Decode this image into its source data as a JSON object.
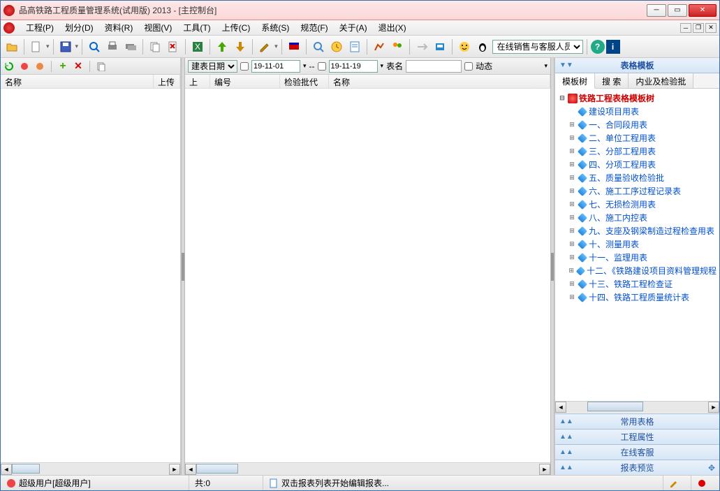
{
  "title": "品高铁路工程质量管理系统(试用版) 2013 - [主控制台]",
  "menu": {
    "project": "工程(P)",
    "division": "划分(D)",
    "data": "资料(R)",
    "view": "视图(V)",
    "tools": "工具(T)",
    "upload": "上传(C)",
    "system": "系统(S)",
    "spec": "规范(F)",
    "about": "关于(A)",
    "exit": "退出(X)"
  },
  "toolbar": {
    "sales_label": "在线销售与客服人员"
  },
  "left": {
    "col_name": "名称",
    "col_upload": "上传"
  },
  "center": {
    "date_type_label": "建表日期",
    "date_from": "19-11-01",
    "date_sep": "--",
    "date_to": "19-11-19",
    "table_name_label": "表名",
    "dynamic_label": "动态",
    "col_upload": "上传",
    "col_number": "编号",
    "col_batch": "检验批代号",
    "col_name": "名称"
  },
  "right": {
    "header": "表格模板",
    "tabs": {
      "tree": "模板树",
      "search": "搜 索",
      "batch": "内业及检验批"
    },
    "root": "铁路工程表格模板树",
    "children": [
      "建设项目用表",
      "一、合同段用表",
      "二、单位工程用表",
      "三、分部工程用表",
      "四、分项工程用表",
      "五、质量验收检验批",
      "六、施工工序过程记录表",
      "七、无损检测用表",
      "八、施工内控表",
      "九、支座及钢梁制造过程检查用表",
      "十、测量用表",
      "十一、监理用表",
      "十二、《铁路建设项目资料管理规程",
      "十三、铁路工程检查证",
      "十四、铁路工程质量统计表"
    ],
    "bars": {
      "common": "常用表格",
      "props": "工程属性",
      "service": "在线客服",
      "preview": "报表预览"
    }
  },
  "status": {
    "user": "超级用户[超级用户]",
    "total": "共:0",
    "hint": "双击报表列表开始编辑报表..."
  }
}
